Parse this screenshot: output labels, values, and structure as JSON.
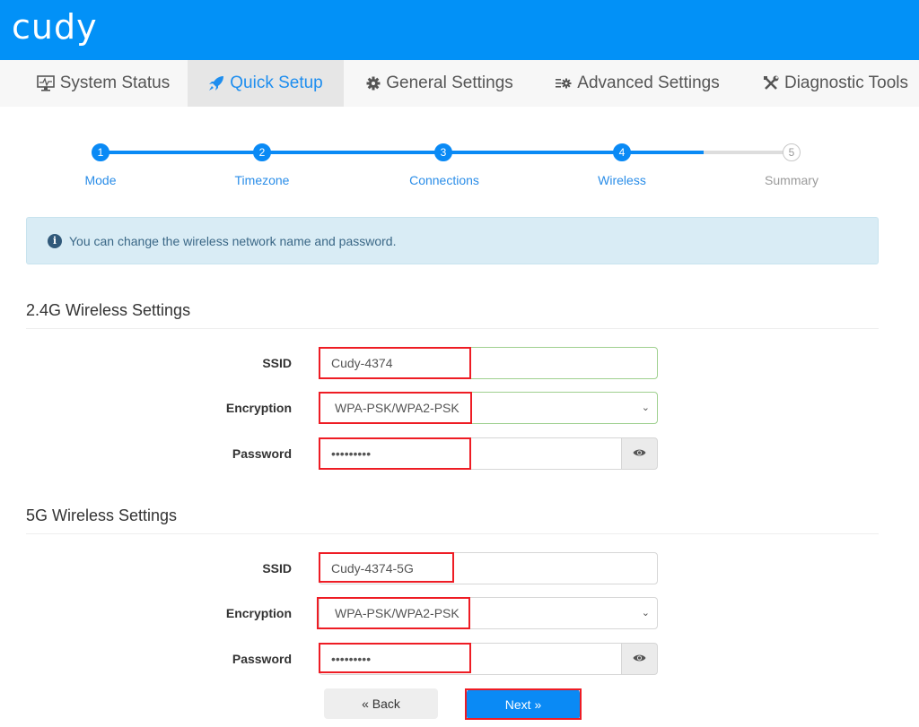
{
  "brand": {
    "logo_text": "cudy",
    "primary_color": "#0291f7"
  },
  "nav": {
    "items": [
      {
        "label": "System Status",
        "icon": "monitor-icon",
        "active": false
      },
      {
        "label": "Quick Setup",
        "icon": "rocket-icon",
        "active": true
      },
      {
        "label": "General Settings",
        "icon": "gear-icon",
        "active": false
      },
      {
        "label": "Advanced Settings",
        "icon": "sliders-gear-icon",
        "active": false
      },
      {
        "label": "Diagnostic Tools",
        "icon": "tools-icon",
        "active": false
      }
    ]
  },
  "stepper": {
    "current_step": 4,
    "steps": [
      {
        "number": "1",
        "label": "Mode",
        "status": "done"
      },
      {
        "number": "2",
        "label": "Timezone",
        "status": "done"
      },
      {
        "number": "3",
        "label": "Connections",
        "status": "done"
      },
      {
        "number": "4",
        "label": "Wireless",
        "status": "current"
      },
      {
        "number": "5",
        "label": "Summary",
        "status": "todo"
      }
    ],
    "progress_between_4_and_5": 0.5
  },
  "alert": {
    "icon": "info-circle-icon",
    "text": "You can change the wireless network name and password."
  },
  "wireless_24g": {
    "title": "2.4G Wireless Settings",
    "ssid_label": "SSID",
    "ssid_value": "Cudy-4374",
    "encryption_label": "Encryption",
    "encryption_value": "WPA-PSK/WPA2-PSK",
    "password_label": "Password",
    "password_masked": "•••••••••"
  },
  "wireless_5g": {
    "title": "5G Wireless Settings",
    "ssid_label": "SSID",
    "ssid_value": "Cudy-4374-5G",
    "encryption_label": "Encryption",
    "encryption_value": "WPA-PSK/WPA2-PSK",
    "password_label": "Password",
    "password_masked": "•••••••••"
  },
  "actions": {
    "back_label": "« Back",
    "next_label": "Next »"
  },
  "highlight_color": "#ee1c24"
}
